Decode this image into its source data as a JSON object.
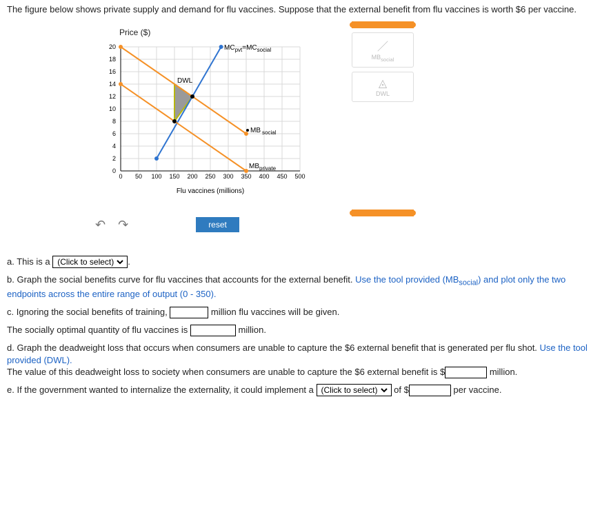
{
  "intro": "The figure below shows private supply and demand for flu vaccines. Suppose that the external benefit from flu vaccines is worth $6 per vaccine.",
  "chart": {
    "y_title": "Price ($)",
    "x_title": "Flu vaccines (millions)",
    "mc_label": "MC",
    "mc_sub1": "pvt",
    "mc_eq": "=MC",
    "mc_sub2": "social",
    "dwl_label": "DWL",
    "mb_label": "MB",
    "mb_social_sub": "social",
    "mb_private_sub": "private"
  },
  "chart_data": {
    "type": "line",
    "xlim": [
      0,
      500
    ],
    "ylim": [
      0,
      20
    ],
    "x_ticks": [
      0,
      50,
      100,
      150,
      200,
      250,
      300,
      350,
      400,
      450,
      500
    ],
    "y_ticks": [
      0,
      2,
      4,
      6,
      8,
      10,
      12,
      14,
      16,
      18,
      20
    ],
    "series": [
      {
        "name": "MCpvt=MCsocial",
        "color": "#2f74d0",
        "points": [
          [
            100,
            2
          ],
          [
            280,
            20
          ]
        ]
      },
      {
        "name": "MBprivate",
        "color": "#f59127",
        "points": [
          [
            0,
            14
          ],
          [
            350,
            0
          ]
        ]
      },
      {
        "name": "MBsocial",
        "color": "#f59127",
        "points": [
          [
            0,
            20
          ],
          [
            350,
            6
          ]
        ]
      }
    ],
    "markers": [
      {
        "name": "DWL-region",
        "vertices": [
          [
            150,
            8
          ],
          [
            150,
            14
          ],
          [
            200,
            12
          ]
        ],
        "fill": "#999",
        "stroke": "#a8a80c"
      }
    ],
    "equilibria": {
      "private_qty": 150,
      "social_qty": 200
    }
  },
  "legend": {
    "mb_social": "MB",
    "mb_social_sub": "social",
    "dwl": "DWL"
  },
  "tools": {
    "reset": "reset"
  },
  "q": {
    "a_pre": "a. This is a ",
    "a_opt": "(Click to select)",
    "b1": "b. Graph the social benefits curve for flu vaccines that accounts for the external benefit. ",
    "b_hint": "Use the tool provided (MB",
    "b_hint_sub": "social",
    "b_hint2": ") and plot only the two endpoints across the entire range of output (0 - 350).",
    "c1": "c. Ignoring the social benefits of training, ",
    "c2": " million flu vaccines will be given.",
    "c3": "The socially optimal quantity of flu vaccines is ",
    "c4": " million.",
    "d1": "d. Graph the deadweight loss that occurs when consumers are unable to capture the $6 external benefit that is generated per flu shot. ",
    "d_hint": "Use the tool provided (DWL).",
    "d2": "The value of this deadweight loss to society when consumers are unable to capture the $6 external benefit is $",
    "d3": " million.",
    "e1": "e. If the government wanted to internalize the externality, it could implement a ",
    "e_opt": "(Click to select)",
    "e2": " of $",
    "e3": " per vaccine."
  }
}
